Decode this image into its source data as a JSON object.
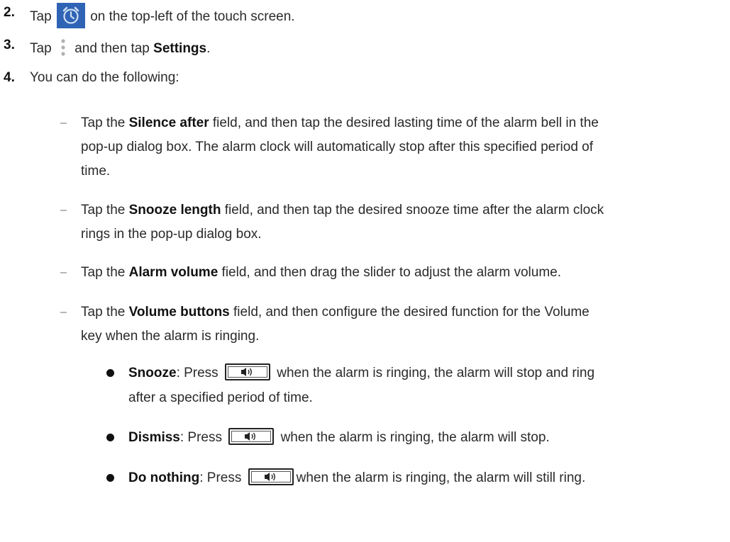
{
  "steps": [
    {
      "num": "2.",
      "pre": "Tap",
      "post": "on the top-left of the touch screen."
    },
    {
      "num": "3.",
      "pre": "Tap",
      "mid": "and then tap",
      "bold": "Settings",
      "post": "."
    },
    {
      "num": "4.",
      "text": "You can do the following:"
    }
  ],
  "options": [
    {
      "pre": "Tap the",
      "bold": "Silence after",
      "line1": "field, and then tap the desired lasting time of the alarm bell in the",
      "line2": "pop-up dialog box. The alarm clock will automatically stop after this specified period of",
      "line3": "time."
    },
    {
      "pre": "Tap the",
      "bold": "Snooze length",
      "line1": "field, and then tap the desired snooze time after the alarm clock",
      "line2": "rings in the pop-up dialog box."
    },
    {
      "pre": "Tap the",
      "bold": "Alarm volume",
      "line1": "field, and then drag the slider to adjust the alarm volume."
    },
    {
      "pre": "Tap the",
      "bold": "Volume buttons",
      "line1": "field, and then configure the desired function for the Volume",
      "line2": "key when the alarm is ringing."
    }
  ],
  "bullets": [
    {
      "bold": "Snooze",
      "pre": ": Press",
      "line1": "when the alarm is ringing, the alarm will stop and ring",
      "line2": "after a specified period of time."
    },
    {
      "bold": "Dismiss",
      "pre": ": Press",
      "line1": "when the alarm is ringing, the alarm will stop."
    },
    {
      "bold": "Do nothing",
      "pre": ": Press",
      "line1": "when the alarm is ringing, the alarm will still ring."
    }
  ],
  "icons": {
    "alarm": "alarm-clock-icon",
    "menu": "more-vertical-icon",
    "volume": "volume-key-icon"
  },
  "colors": {
    "alarm_icon_bg": "#2f63b5",
    "text": "#2a2a2a"
  }
}
